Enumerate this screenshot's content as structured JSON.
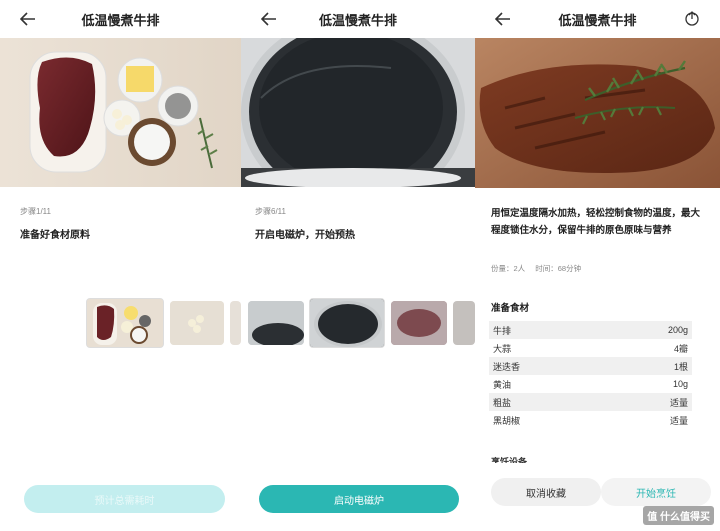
{
  "screen1": {
    "title": "低温慢煮牛排",
    "step_num": "步骤1/11",
    "step_title": "准备好食材原料",
    "button": "预计总需耗时"
  },
  "screen2": {
    "title": "低温慢煮牛排",
    "step_num": "步骤6/11",
    "step_title": "开启电磁炉，开始预热",
    "button": "启动电磁炉"
  },
  "screen3": {
    "title": "低温慢煮牛排",
    "description": "用恒定温度隔水加热，轻松控制食物的温度，最大程度锁住水分，保留牛排的原色原味与营养",
    "servings": "份量：2人",
    "time": "时间：68分钟",
    "ingredients_title": "准备食材",
    "ingredients": [
      {
        "name": "牛排",
        "qty": "200g"
      },
      {
        "name": "大蒜",
        "qty": "4瓣"
      },
      {
        "name": "迷迭香",
        "qty": "1根"
      },
      {
        "name": "黄油",
        "qty": "10g"
      },
      {
        "name": "粗盐",
        "qty": "适量"
      },
      {
        "name": "黑胡椒",
        "qty": "适量"
      }
    ],
    "equipment_title": "烹饪设备",
    "cancel_button": "取消收藏",
    "start_button": "开始烹饪",
    "watermark": "值 什么值得买"
  },
  "colors": {
    "accent": "#2bb7b3",
    "accent_disabled": "#c3eeef",
    "stripe": "#f0f0f0"
  },
  "icons": [
    "back-arrow-icon",
    "share-icon"
  ]
}
